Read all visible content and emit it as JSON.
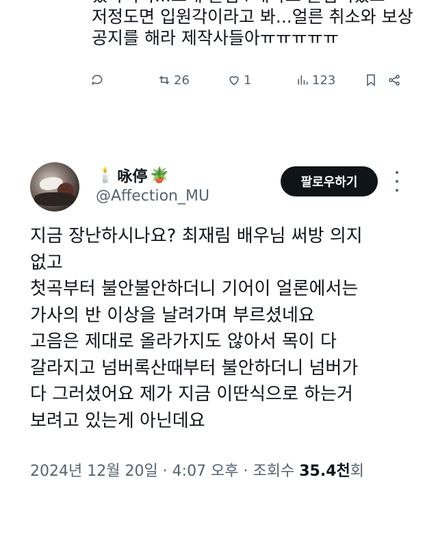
{
  "previous_tweet": {
    "lines": [
      "었다니까...노래 틀림+내사도 틀림이었고",
      "저정도면 입원각이라고 봐...얼른 취소와 보상",
      "공지를 해라 제작사들아ㅠㅠㅠㅠㅠ"
    ],
    "actions": {
      "reply_icon": "reply-icon",
      "retweet_icon": "retweet-icon",
      "retweet_count": "26",
      "like_icon": "heart-icon",
      "like_count": "1",
      "views_icon": "bar-chart-icon",
      "views_count": "123",
      "bookmark_icon": "bookmark-icon",
      "share_icon": "share-icon"
    }
  },
  "tweet": {
    "author": {
      "name": "咏停",
      "name_prefix_emoji": "🕯️",
      "name_suffix_emoji": "🪴",
      "handle": "@Affection_MU"
    },
    "follow_label": "팔로우하기",
    "more_icon": "more-vertical-icon",
    "text_lines": [
      "지금 장난하시나요? 최재림 배우님 써방 의지",
      "없고",
      "첫곡부터 불안불안하더니 기어이 얼론에서는",
      "가사의 반 이상을 날려가며 부르셨네요",
      "고음은 제대로 올라가지도 않아서 목이 다",
      "갈라지고 넘버록산때부터 불안하더니 넘버가",
      "다 그러셨어요 제가 지금 이딴식으로 하는거",
      "보려고 있는게 아닌데요"
    ],
    "meta": {
      "timestamp": "2024년 12월 20일 · 4:07 오후 · 조회수 ",
      "views": "35.4천",
      "views_suffix": "회"
    }
  },
  "colors": {
    "text": "#0f1419",
    "secondary": "#536471",
    "button_bg": "#0f1419",
    "button_text": "#ffffff"
  }
}
